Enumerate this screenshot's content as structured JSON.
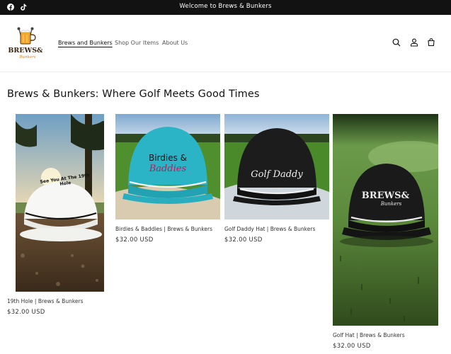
{
  "announcement": {
    "text": "Welcome to Brews & Bunkers"
  },
  "social": {
    "facebook_icon": "facebook-icon",
    "tiktok_icon": "tiktok-icon"
  },
  "header": {
    "logo_alt": "Brews & Bunkers",
    "nav": [
      {
        "label": "Brews and Bunkers",
        "active": true
      },
      {
        "label": "Shop Our Items",
        "active": false
      },
      {
        "label": "About Us",
        "active": false
      }
    ],
    "icons": [
      "search-icon",
      "account-icon",
      "cart-icon"
    ]
  },
  "collection": {
    "title": "Brews & Bunkers: Where Golf Meets Good Times",
    "products": [
      {
        "name": "19th Hole | Brews & Bunkers",
        "price": "$32.00 USD",
        "hat_text": "See You At The 19th Hole"
      },
      {
        "name": "Birdies & Baddies | Brews & Bunkers",
        "price": "$32.00 USD",
        "hat_text_1": "Birdies &",
        "hat_text_2": "Baddies"
      },
      {
        "name": "Golf Daddy Hat | Brews & Bunkers",
        "price": "$32.00 USD",
        "hat_text": "Golf Daddy"
      },
      {
        "name": "Golf Hat | Brews & Bunkers",
        "price": "$32.00 USD",
        "hat_text_1": "BREWS&",
        "hat_text_2": "Bunkers"
      }
    ]
  },
  "colors": {
    "announcement_bg": "#121212",
    "accent_pink": "#c2185b",
    "cap_teal": "#2bb3c6"
  }
}
